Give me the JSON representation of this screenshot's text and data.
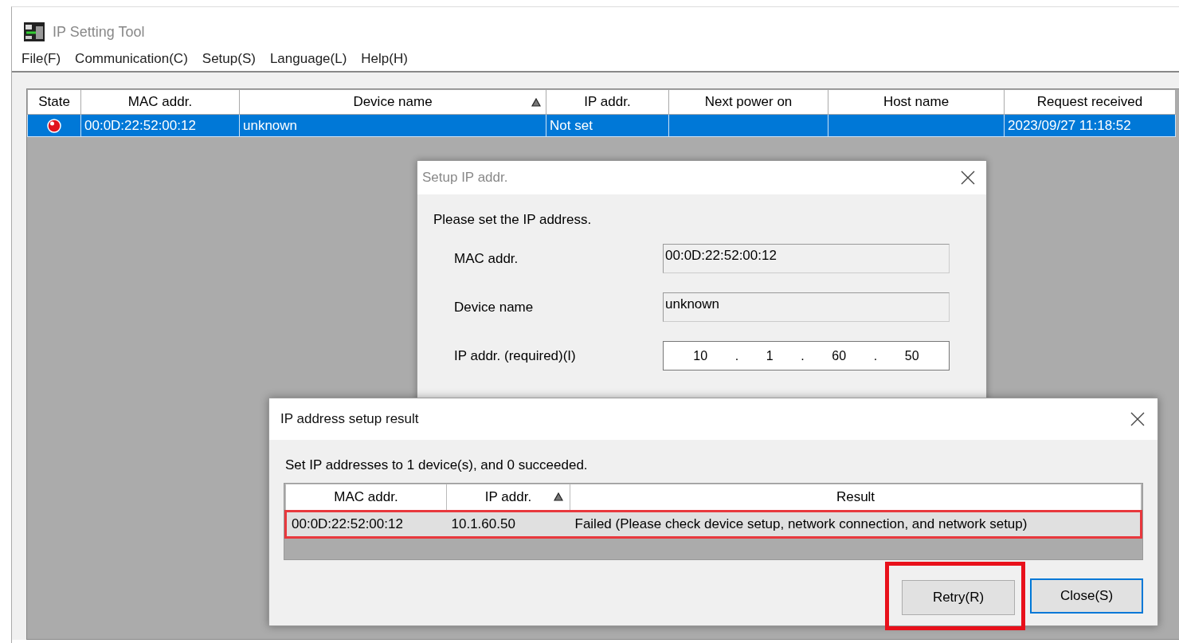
{
  "window": {
    "title": "IP Setting Tool"
  },
  "menu": [
    {
      "label": "File(F)"
    },
    {
      "label": "Communication(C)"
    },
    {
      "label": "Setup(S)"
    },
    {
      "label": "Language(L)"
    },
    {
      "label": "Help(H)"
    }
  ],
  "device_table": {
    "columns": [
      {
        "label": "State",
        "sorted": false
      },
      {
        "label": "MAC addr.",
        "sorted": false
      },
      {
        "label": "Device name",
        "sorted": true
      },
      {
        "label": "IP addr.",
        "sorted": false
      },
      {
        "label": "Next power on",
        "sorted": false
      },
      {
        "label": "Host name",
        "sorted": false
      },
      {
        "label": "Request received",
        "sorted": false
      }
    ],
    "rows": [
      {
        "selected": true,
        "color": "#e0141e",
        "cells": [
          "",
          "00:0D:22:52:00:12",
          "unknown",
          "Not set",
          "",
          "",
          "2023/09/27 11:18:52"
        ]
      }
    ]
  },
  "setup_dialog": {
    "title": "Setup IP addr.",
    "instruction": "Please set the IP address.",
    "fields": [
      {
        "kind": "readonly",
        "label": "MAC addr.",
        "value": "00:0D:22:52:00:12"
      },
      {
        "kind": "readonly",
        "label": "Device name",
        "value": "unknown"
      },
      {
        "kind": "ip",
        "label": "IP addr. (required)(I)",
        "parts": [
          "10",
          ".",
          "1",
          ".",
          "60",
          ".",
          "50"
        ]
      }
    ]
  },
  "result_dialog": {
    "title": "IP address setup result",
    "message": "Set IP addresses to 1 device(s), and 0 succeeded.",
    "columns": [
      {
        "label": "MAC addr.",
        "sorted": false
      },
      {
        "label": "IP addr.",
        "sorted": true
      },
      {
        "label": "Result",
        "sorted": false
      }
    ],
    "rows": [
      {
        "highlighted": true,
        "cells": [
          "00:0D:22:52:00:12",
          "10.1.60.50",
          "Failed (Please check device setup, network connection, and network setup)"
        ]
      }
    ],
    "buttons": [
      {
        "label": "Retry(R)",
        "default": false,
        "highlighted": true
      },
      {
        "label": "Close(S)",
        "default": true,
        "highlighted": false
      }
    ]
  }
}
